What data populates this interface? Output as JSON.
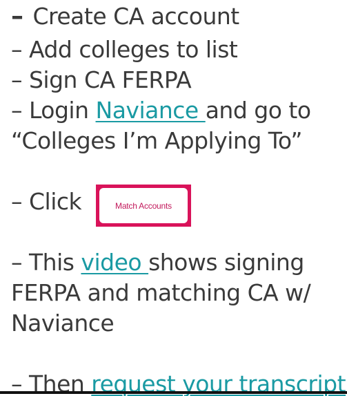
{
  "steps": {
    "create_dash": "–",
    "create": "Create CA account",
    "add": "– Add colleges to list",
    "sign": "– Sign CA FERPA",
    "login_prefix": "– Login ",
    "naviance_link": "Naviance ",
    "login_suffix": " and go to",
    "colleges": "“Colleges I’m Applying To”",
    "click_prefix": "– Click ",
    "match_button": "Match Accounts",
    "this_prefix": "– This ",
    "video_link": "video ",
    "this_suffix": " shows signing",
    "ferpa_line": "FERPA and matching CA w/",
    "naviance_line": "Naviance",
    "then_prefix": "– Then ",
    "transcript_link": "request your transcript"
  },
  "colors": {
    "text": "#3a3a3a",
    "link": "#1a9aa3",
    "button_border": "#d9135a",
    "button_text": "#c2185b"
  }
}
